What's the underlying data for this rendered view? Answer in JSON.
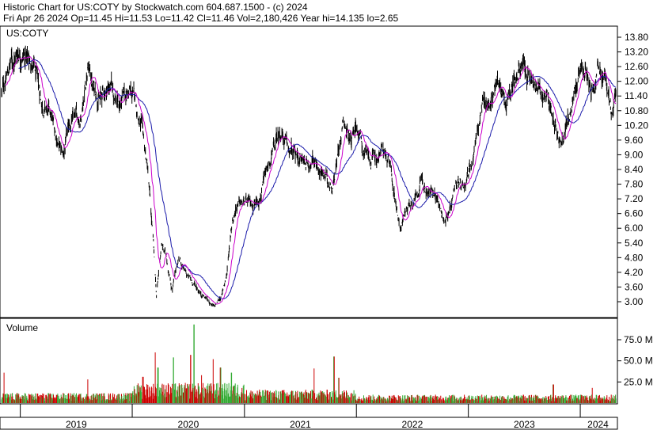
{
  "header": {
    "line1": "Historic Chart for US:COTY by Stockwatch.com 604.687.1500 - (c) 2024",
    "line2": "Fri Apr 26 2024   Op=11.45  Hi=11.53  Lo=11.42  Cl=11.46  Vol=2,180,426   Year hi=14.135  lo=2.65"
  },
  "chart_data": {
    "type": "line",
    "symbol_label": "US:COTY",
    "volume_label": "Volume",
    "x_labels": [
      "2019",
      "2020",
      "2021",
      "2022",
      "2023",
      "2024"
    ],
    "price_ticks": [
      "13.80",
      "13.20",
      "12.60",
      "12.00",
      "11.40",
      "10.80",
      "10.20",
      "9.60",
      "9.00",
      "8.40",
      "7.80",
      "7.20",
      "6.60",
      "6.00",
      "5.40",
      "4.80",
      "4.20",
      "3.60",
      "3.00"
    ],
    "volume_ticks": [
      "75.0 M",
      "50.0 M",
      "25.0 M"
    ],
    "price_range": [
      2.65,
      14.135
    ],
    "volume_range_m": [
      0,
      95
    ],
    "price_anchors": [
      {
        "d": "2018-11-01",
        "p": 11.5
      },
      {
        "d": "2018-12-01",
        "p": 12.8
      },
      {
        "d": "2019-01-01",
        "p": 13.3
      },
      {
        "d": "2019-02-10",
        "p": 12.7
      },
      {
        "d": "2019-03-10",
        "p": 11.2
      },
      {
        "d": "2019-04-10",
        "p": 10.5
      },
      {
        "d": "2019-05-20",
        "p": 8.9
      },
      {
        "d": "2019-06-15",
        "p": 10.3
      },
      {
        "d": "2019-07-15",
        "p": 10.5
      },
      {
        "d": "2019-08-10",
        "p": 12.8
      },
      {
        "d": "2019-08-25",
        "p": 11.8
      },
      {
        "d": "2019-09-20",
        "p": 11.3
      },
      {
        "d": "2019-10-20",
        "p": 11.9
      },
      {
        "d": "2019-11-20",
        "p": 11.0
      },
      {
        "d": "2019-12-20",
        "p": 11.6
      },
      {
        "d": "2020-01-10",
        "p": 11.2
      },
      {
        "d": "2020-01-30",
        "p": 10.1
      },
      {
        "d": "2020-02-20",
        "p": 8.4
      },
      {
        "d": "2020-03-10",
        "p": 5.3
      },
      {
        "d": "2020-03-20",
        "p": 3.2
      },
      {
        "d": "2020-04-05",
        "p": 5.3
      },
      {
        "d": "2020-04-20",
        "p": 4.9
      },
      {
        "d": "2020-05-10",
        "p": 3.5
      },
      {
        "d": "2020-06-01",
        "p": 4.8
      },
      {
        "d": "2020-06-20",
        "p": 4.2
      },
      {
        "d": "2020-07-15",
        "p": 3.8
      },
      {
        "d": "2020-08-10",
        "p": 3.4
      },
      {
        "d": "2020-09-10",
        "p": 3.0
      },
      {
        "d": "2020-09-25",
        "p": 2.75
      },
      {
        "d": "2020-10-20",
        "p": 3.3
      },
      {
        "d": "2020-11-05",
        "p": 4.2
      },
      {
        "d": "2020-11-20",
        "p": 6.2
      },
      {
        "d": "2020-12-05",
        "p": 7.0
      },
      {
        "d": "2020-12-31",
        "p": 7.0
      },
      {
        "d": "2021-01-25",
        "p": 6.9
      },
      {
        "d": "2021-02-25",
        "p": 7.5
      },
      {
        "d": "2021-03-25",
        "p": 8.6
      },
      {
        "d": "2021-04-15",
        "p": 9.5
      },
      {
        "d": "2021-05-01",
        "p": 10.0
      },
      {
        "d": "2021-05-20",
        "p": 9.2
      },
      {
        "d": "2021-06-20",
        "p": 8.9
      },
      {
        "d": "2021-07-20",
        "p": 8.7
      },
      {
        "d": "2021-08-20",
        "p": 8.8
      },
      {
        "d": "2021-09-20",
        "p": 8.0
      },
      {
        "d": "2021-10-15",
        "p": 7.8
      },
      {
        "d": "2021-11-01",
        "p": 9.0
      },
      {
        "d": "2021-11-20",
        "p": 10.7
      },
      {
        "d": "2021-12-10",
        "p": 9.6
      },
      {
        "d": "2021-12-31",
        "p": 10.5
      },
      {
        "d": "2022-01-20",
        "p": 9.3
      },
      {
        "d": "2022-02-15",
        "p": 8.7
      },
      {
        "d": "2022-03-10",
        "p": 8.9
      },
      {
        "d": "2022-03-31",
        "p": 9.2
      },
      {
        "d": "2022-04-20",
        "p": 8.4
      },
      {
        "d": "2022-05-10",
        "p": 7.0
      },
      {
        "d": "2022-05-25",
        "p": 6.1
      },
      {
        "d": "2022-06-15",
        "p": 6.9
      },
      {
        "d": "2022-07-10",
        "p": 7.3
      },
      {
        "d": "2022-08-01",
        "p": 8.0
      },
      {
        "d": "2022-08-20",
        "p": 7.3
      },
      {
        "d": "2022-09-15",
        "p": 7.6
      },
      {
        "d": "2022-10-10",
        "p": 6.4
      },
      {
        "d": "2022-10-31",
        "p": 6.6
      },
      {
        "d": "2022-11-20",
        "p": 7.4
      },
      {
        "d": "2022-12-15",
        "p": 7.8
      },
      {
        "d": "2023-01-10",
        "p": 8.6
      },
      {
        "d": "2023-02-01",
        "p": 10.2
      },
      {
        "d": "2023-02-20",
        "p": 11.0
      },
      {
        "d": "2023-03-15",
        "p": 11.2
      },
      {
        "d": "2023-04-10",
        "p": 12.0
      },
      {
        "d": "2023-05-05",
        "p": 11.2
      },
      {
        "d": "2023-05-31",
        "p": 12.2
      },
      {
        "d": "2023-06-20",
        "p": 12.6
      },
      {
        "d": "2023-07-10",
        "p": 12.2
      },
      {
        "d": "2023-07-31",
        "p": 11.8
      },
      {
        "d": "2023-08-25",
        "p": 11.4
      },
      {
        "d": "2023-09-20",
        "p": 11.2
      },
      {
        "d": "2023-10-15",
        "p": 10.2
      },
      {
        "d": "2023-10-31",
        "p": 9.3
      },
      {
        "d": "2023-11-20",
        "p": 10.3
      },
      {
        "d": "2023-12-10",
        "p": 11.3
      },
      {
        "d": "2023-12-31",
        "p": 12.3
      },
      {
        "d": "2024-01-20",
        "p": 12.5
      },
      {
        "d": "2024-02-10",
        "p": 12.0
      },
      {
        "d": "2024-03-01",
        "p": 13.0
      },
      {
        "d": "2024-03-15",
        "p": 12.2
      },
      {
        "d": "2024-04-01",
        "p": 11.4
      },
      {
        "d": "2024-04-15",
        "p": 10.7
      },
      {
        "d": "2024-04-26",
        "p": 11.46
      }
    ],
    "volume_spikes_m": [
      {
        "d": "2018-11-10",
        "v": 36
      },
      {
        "d": "2019-08-10",
        "v": 28
      },
      {
        "d": "2020-02-05",
        "v": 31
      },
      {
        "d": "2020-03-15",
        "v": 60
      },
      {
        "d": "2020-03-25",
        "v": 42
      },
      {
        "d": "2020-05-15",
        "v": 54
      },
      {
        "d": "2020-07-10",
        "v": 57
      },
      {
        "d": "2020-07-20",
        "v": 93
      },
      {
        "d": "2020-08-15",
        "v": 33
      },
      {
        "d": "2020-09-20",
        "v": 52
      },
      {
        "d": "2020-10-15",
        "v": 42
      },
      {
        "d": "2020-11-20",
        "v": 36
      },
      {
        "d": "2021-08-15",
        "v": 41
      },
      {
        "d": "2021-10-20",
        "v": 55
      },
      {
        "d": "2021-11-05",
        "v": 30
      },
      {
        "d": "2023-10-05",
        "v": 22
      },
      {
        "d": "2024-02-10",
        "v": 18
      }
    ],
    "series": [
      {
        "type": "line",
        "values_ref": "price_anchors",
        "color": "#000000",
        "style": "daily high-low bars"
      },
      {
        "type": "line",
        "color": "#cc00cc",
        "style": "short moving average"
      },
      {
        "type": "line",
        "color": "#1a1aaa",
        "style": "long moving average"
      },
      {
        "type": "bar",
        "values_ref": "volume_spikes_m",
        "colors": [
          "#cc0000",
          "#33aa33"
        ]
      }
    ],
    "grid": false,
    "start_date": "2018-11-01",
    "end_date": "2024-04-26"
  }
}
